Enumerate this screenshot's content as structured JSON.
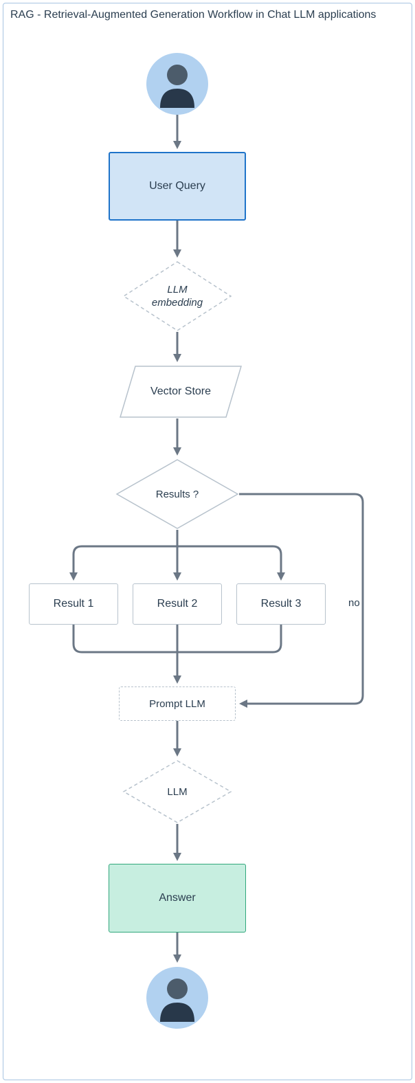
{
  "title": "RAG - Retrieval-Augmented Generation Workflow in Chat LLM applications",
  "nodes": {
    "user_query": "User Query",
    "llm_embedding": "LLM embedding",
    "vector_store": "Vector Store",
    "results_decision": "Results ?",
    "result1": "Result 1",
    "result2": "Result 2",
    "result3": "Result 3",
    "prompt_llm": "Prompt LLM",
    "llm": "LLM",
    "answer": "Answer"
  },
  "edges": {
    "no": "no"
  },
  "colors": {
    "border_blue": "#1e73c9",
    "fill_blue": "#d1e4f6",
    "border_green": "#2fa67a",
    "fill_green": "#c7eee0",
    "gray": "#6b7785",
    "light_border": "#b7c2cc",
    "user_bg": "#b1d1f0",
    "user_fg": "#28384a"
  }
}
